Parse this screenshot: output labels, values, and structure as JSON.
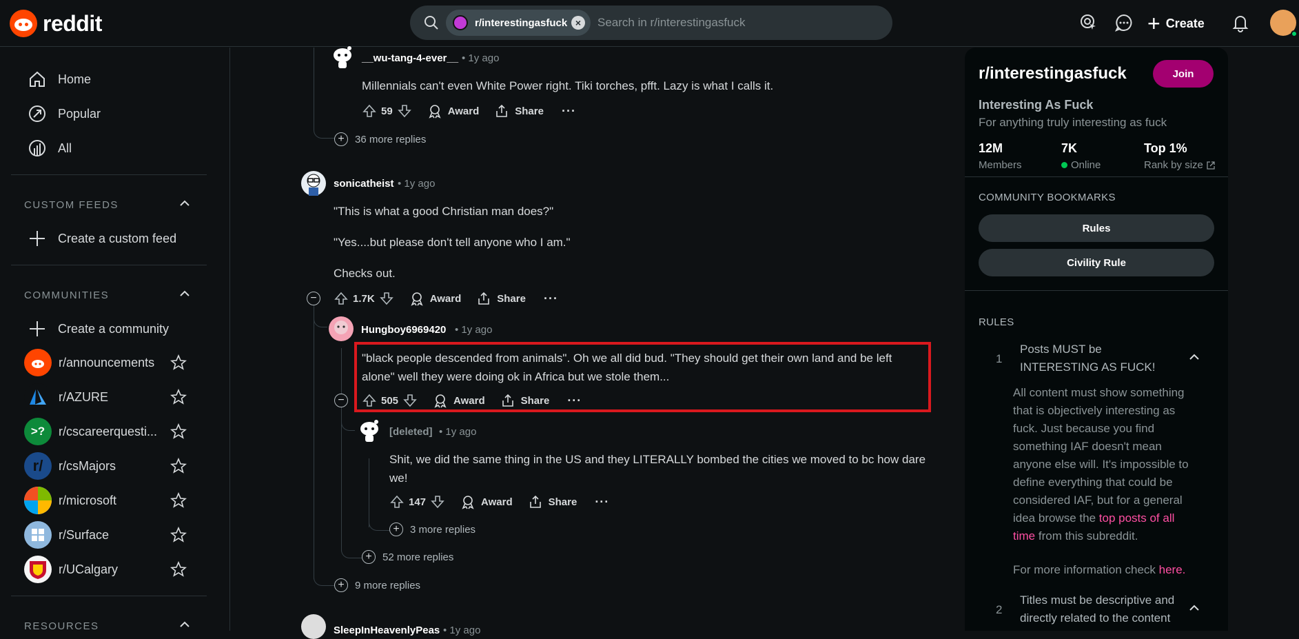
{
  "header": {
    "logo_text": "reddit",
    "search_chip": "r/interestingasfuck",
    "search_placeholder": "Search in r/interestingasfuck",
    "create_label": "Create"
  },
  "leftnav": {
    "items": [
      {
        "label": "Home",
        "icon": "home-icon"
      },
      {
        "label": "Popular",
        "icon": "popular-icon"
      },
      {
        "label": "All",
        "icon": "all-icon"
      }
    ],
    "custom_feeds_heading": "CUSTOM FEEDS",
    "create_feed": "Create a custom feed",
    "communities_heading": "COMMUNITIES",
    "create_community": "Create a community",
    "communities": [
      {
        "name": "r/announcements",
        "color": "#ff4500",
        "glyph": "●"
      },
      {
        "name": "r/AZURE",
        "color": "#0e1113",
        "glyph": "A"
      },
      {
        "name": "r/cscareerquesti...",
        "color": "#0d8a3a",
        "glyph": ">?"
      },
      {
        "name": "r/csMajors",
        "color": "#1a4a8a",
        "glyph": "r/"
      },
      {
        "name": "r/microsoft",
        "color": "#ffffff",
        "glyph": ""
      },
      {
        "name": "r/Surface",
        "color": "#6fa8dc",
        "glyph": "⊞"
      },
      {
        "name": "r/UCalgary",
        "color": "#f5f5f5",
        "glyph": "◆"
      }
    ],
    "resources_heading": "RESOURCES"
  },
  "comments": {
    "c1": {
      "author": "__wu-tang-4-ever__",
      "time": "1y ago",
      "body": "Millennials can't even White Power right. Tiki torches, pfft. Lazy is what I calls it.",
      "score": "59",
      "more_replies": "36 more replies"
    },
    "c2": {
      "author": "sonicatheist",
      "time": "1y ago",
      "body_lines": [
        "\"This is what a good Christian man does?\"",
        "\"Yes....but please don't tell anyone who I am.\"",
        "Checks out."
      ],
      "score": "1.7K"
    },
    "c3": {
      "author": "Hungboy6969420",
      "time": "1y ago",
      "body": "\"black people descended from animals\". Oh we all did bud. \"They should get their own land and be left alone\" well they were doing ok in Africa but we stole them...",
      "score": "505"
    },
    "c4": {
      "author": "[deleted]",
      "time": "1y ago",
      "body": "Shit, we did the same thing in the US and they LITERALLY bombed the cities we moved to bc how dare we!",
      "score": "147",
      "more_replies": "3 more replies"
    },
    "more_c3": "52 more replies",
    "more_c2": "9 more replies",
    "c5": {
      "author": "SleepInHeavenlyPeas",
      "time": "1y ago"
    },
    "award_label": "Award",
    "share_label": "Share",
    "more_label": "···"
  },
  "sidebar": {
    "title": "r/interestingasfuck",
    "join_label": "Join",
    "name": "Interesting As Fuck",
    "description": "For anything truly interesting as fuck",
    "stats": [
      {
        "value": "12M",
        "label": "Members"
      },
      {
        "value": "7K",
        "label": "Online"
      },
      {
        "value": "Top 1%",
        "label": "Rank by size"
      }
    ],
    "bookmarks_heading": "COMMUNITY BOOKMARKS",
    "bookmarks": [
      "Rules",
      "Civility Rule"
    ],
    "rules_heading": "RULES",
    "rules": [
      {
        "num": "1",
        "title": "Posts MUST be INTERESTING AS FUCK!"
      },
      {
        "num": "2",
        "title": "Titles must be descriptive and directly related to the content"
      }
    ],
    "rule1_body_a": "All content must show something that is objectively interesting as fuck. Just because you find something IAF doesn't mean anyone else will. It's impossible to define everything that could be considered IAF, but for a general idea browse the",
    "rule1_link": "top posts of all time",
    "rule1_body_b": "from this subreddit.",
    "rule1_more_a": "For more information check",
    "rule1_more_link": "here",
    "rule1_more_b": "."
  },
  "colors": {
    "accent": "#a30070",
    "highlight": "#d9191e",
    "link": "#ff4fa3",
    "bg": "#0e1113"
  }
}
